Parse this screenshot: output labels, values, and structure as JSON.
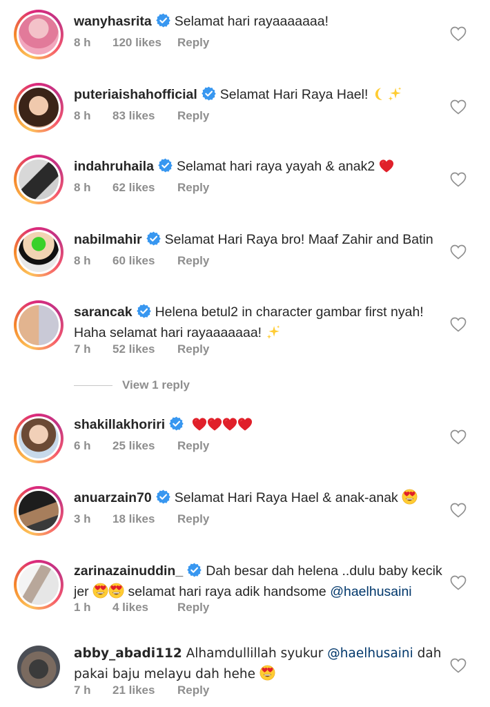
{
  "colors": {
    "text": "#262626",
    "secondary": "#8e8e8e",
    "mention": "#00376b",
    "verified": "#3897f0",
    "heart_red": "#ed1c24"
  },
  "comments": [
    {
      "username": "wanyhasrita",
      "verified": true,
      "text": "Selamat hari rayaaaaaaa!",
      "time": "8 h",
      "likes": "120 likes",
      "reply": "Reply"
    },
    {
      "username": "puteriaishahofficial",
      "verified": true,
      "text": "Selamat Hari Raya Hael!",
      "text_emoji": "crescent-moon+sparkles",
      "time": "8 h",
      "likes": "83 likes",
      "reply": "Reply"
    },
    {
      "username": "indahruhaila",
      "verified": true,
      "text": "Selamat hari raya yayah & anak2",
      "text_emoji": "red-heart",
      "time": "8 h",
      "likes": "62 likes",
      "reply": "Reply"
    },
    {
      "username": "nabilmahir",
      "verified": true,
      "text": "Selamat Hari Raya bro! Maaf Zahir and Batin",
      "time": "8 h",
      "likes": "60 likes",
      "reply": "Reply"
    },
    {
      "username": "sarancak",
      "verified": true,
      "text": "Helena betul2 in character gambar first nyah!",
      "text2": "Haha selamat hari rayaaaaaaa!",
      "text_emoji": "sparkles",
      "time": "7 h",
      "likes": "52 likes",
      "reply": "Reply"
    },
    {
      "username": "shakillakhoriri",
      "verified": true,
      "text_emoji": "red-heart x4",
      "time": "6 h",
      "likes": "25 likes",
      "reply": "Reply"
    },
    {
      "username": "anuarzain70",
      "verified": true,
      "text": "Selamat Hari Raya Hael & anak-anak",
      "text_emoji": "heart-eyes",
      "time": "3 h",
      "likes": "18 likes",
      "reply": "Reply"
    },
    {
      "username": "zarinazainuddin_",
      "verified": true,
      "text": "Dah besar dah helena ..dulu baby kecik",
      "text2a": "jer",
      "text2b": "selamat hari raya adik handsome",
      "mention": "@haelhusaini",
      "text_emoji": "heart-eyes x2",
      "time": "1 h",
      "likes": "4 likes",
      "reply": "Reply"
    },
    {
      "username": "abby_abadi112",
      "verified": false,
      "text": "Alhamdullillah syukur",
      "mention": "@haelhusaini",
      "text_after": "dah",
      "text2": "pakai baju melayu dah hehe",
      "text_emoji": "heart-eyes",
      "time": "7 h",
      "likes": "21 likes",
      "reply": "Reply"
    }
  ],
  "view_replies": "View 1 reply",
  "icons": {
    "like": "heart-outline-icon",
    "verified": "verified-badge-icon"
  }
}
